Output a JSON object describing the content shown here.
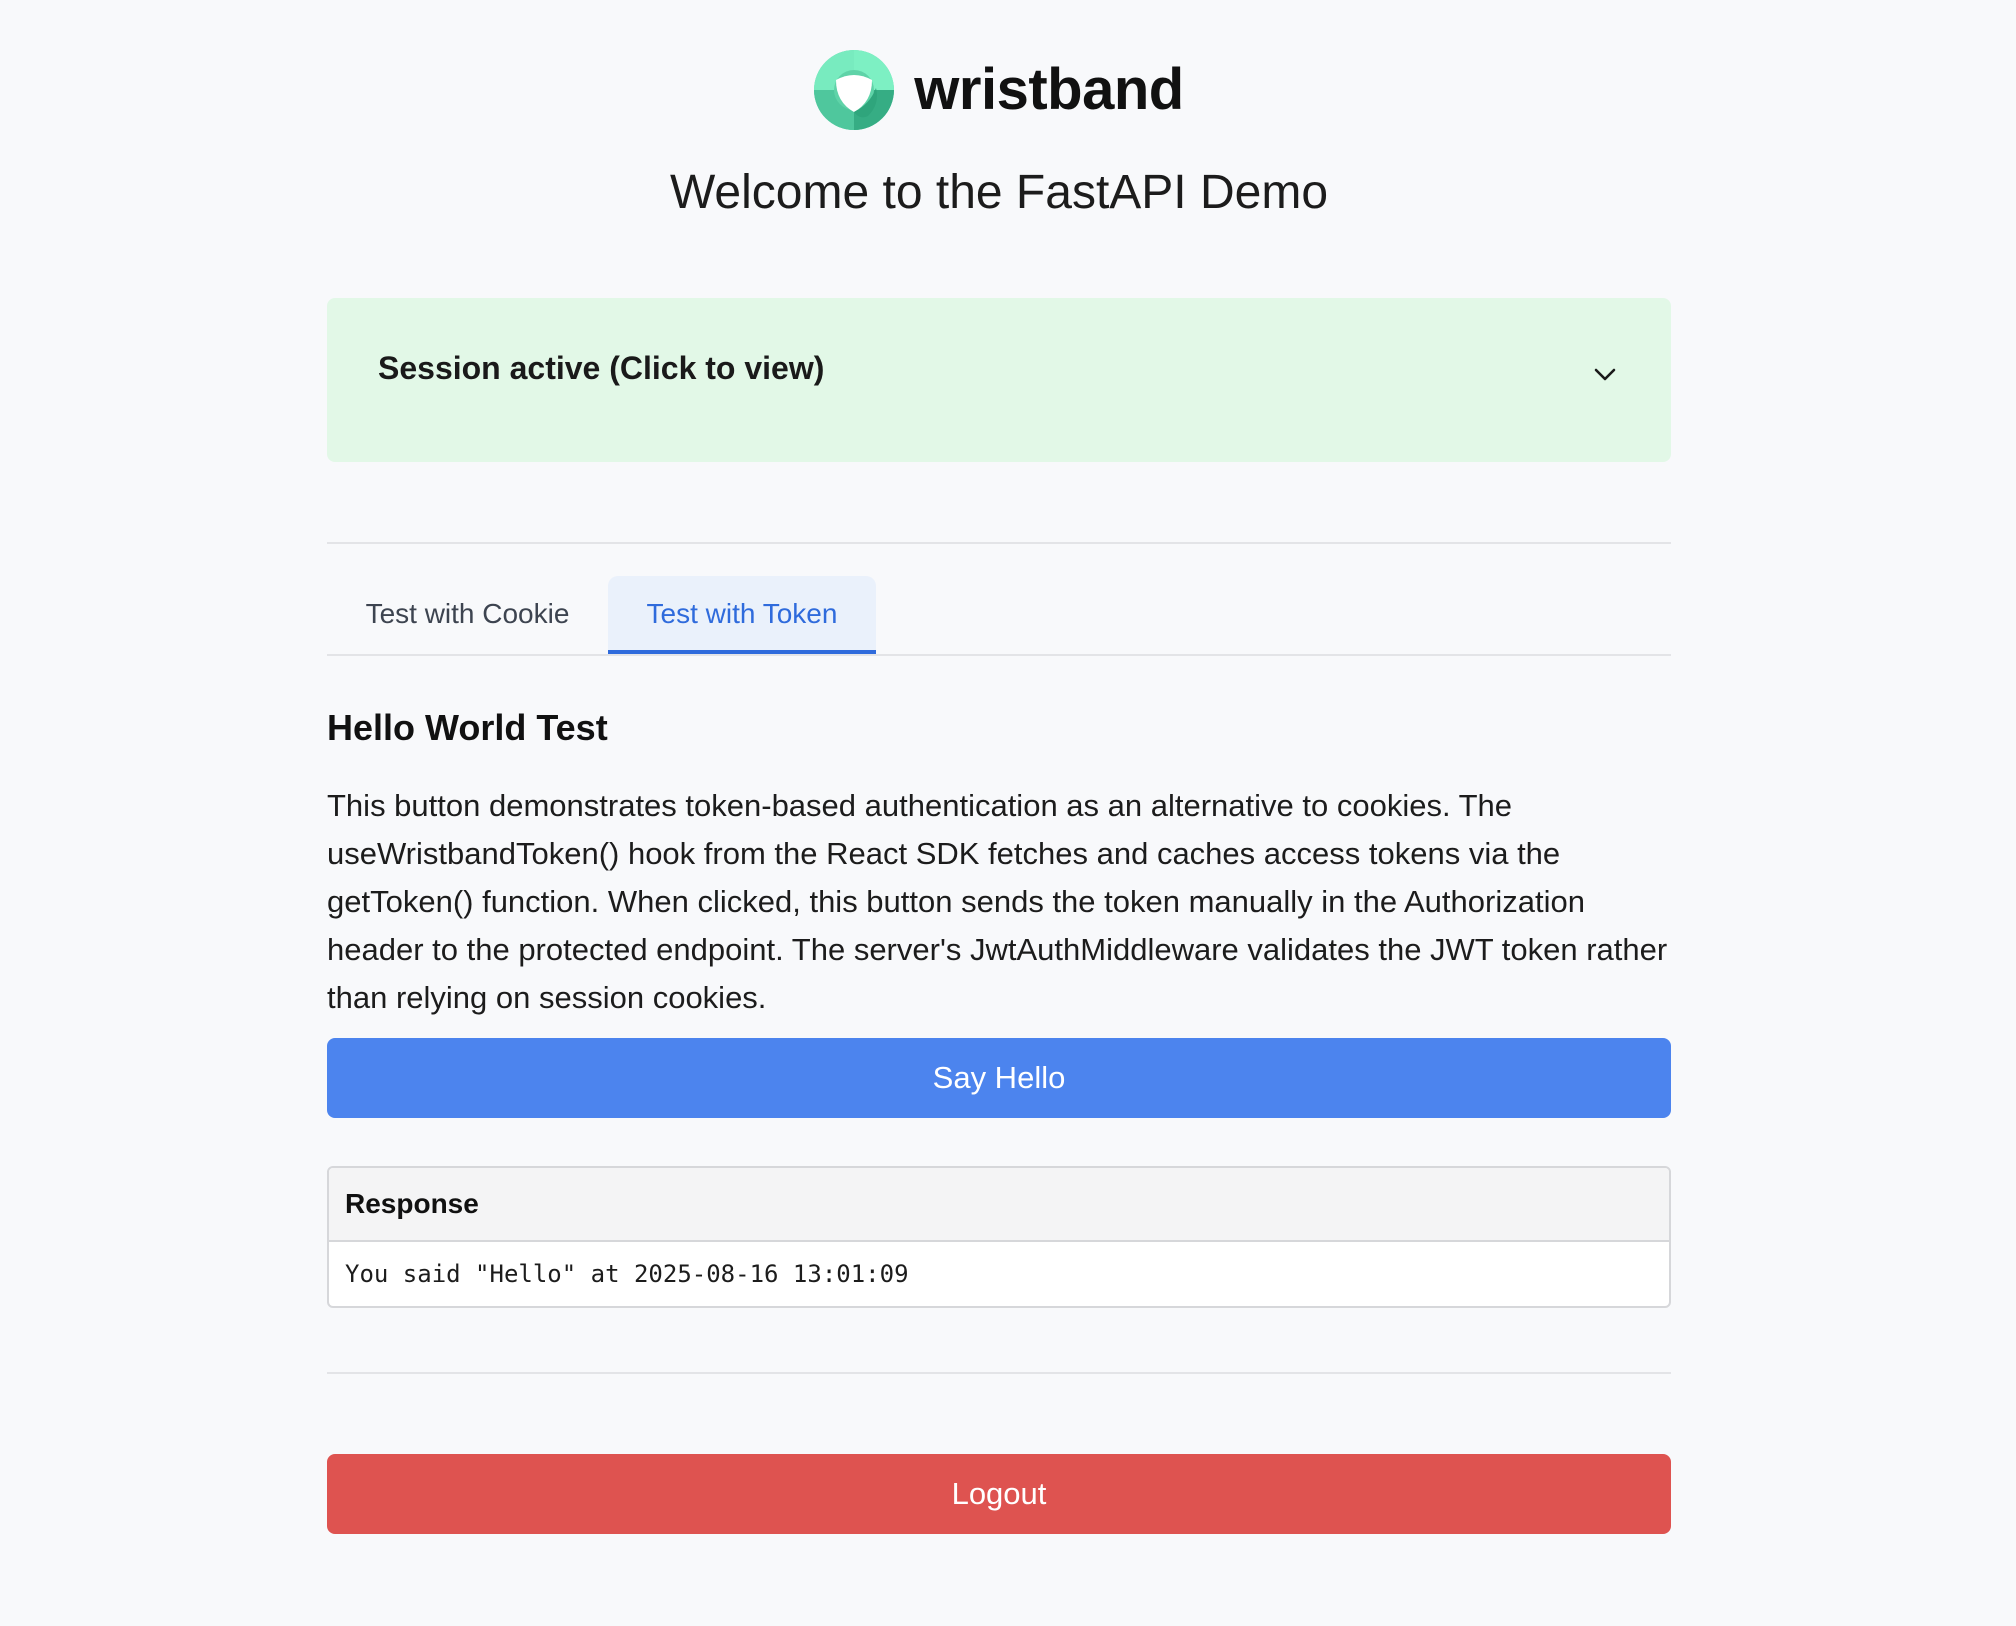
{
  "brand": {
    "name": "wristband",
    "logo_icon": "wristband-logo-icon",
    "logo_colors": [
      "#7df0c3",
      "#4fc79d",
      "#2fa57c"
    ]
  },
  "page": {
    "title": "Welcome to the FastAPI Demo"
  },
  "session": {
    "label": "Session active (Click to view)",
    "toggle_icon": "chevron-down-icon",
    "background": "#e2f8e7"
  },
  "tabs": [
    {
      "label": "Test with Cookie",
      "active": false
    },
    {
      "label": "Test with Token",
      "active": true
    }
  ],
  "section": {
    "heading": "Hello World Test",
    "description": "This button demonstrates token-based authentication as an alternative to cookies. The useWristbandToken() hook from the React SDK fetches and caches access tokens via the getToken() function. When clicked, this button sends the token manually in the Authorization header to the protected endpoint. The server's JwtAuthMiddleware validates the JWT token rather than relying on session cookies."
  },
  "actions": {
    "say_hello_label": "Say Hello",
    "logout_label": "Logout"
  },
  "response": {
    "title": "Response",
    "text": "You said \"Hello\" at 2025-08-16 13:01:09"
  },
  "colors": {
    "accent": "#2f6bdc",
    "primary_button": "#4c84ee",
    "danger_button": "#de5350",
    "page_background": "#f8f9fb"
  }
}
